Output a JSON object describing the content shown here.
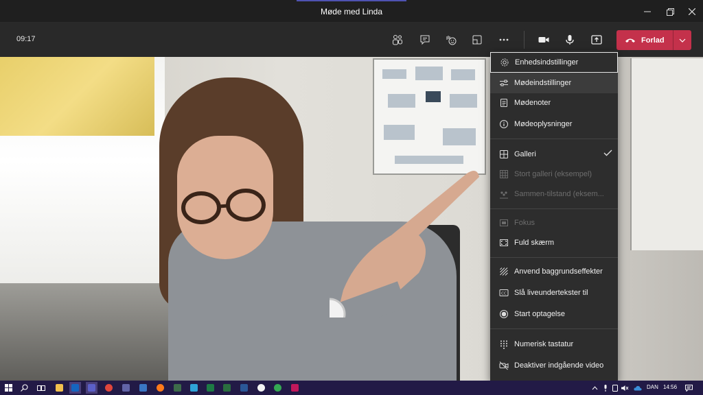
{
  "window": {
    "title": "Møde med Linda"
  },
  "toolbar": {
    "time": "09:17",
    "leave_label": "Forlad",
    "buttons": [
      "people-icon",
      "chat-icon",
      "raise-hand-icon",
      "breakout-icon",
      "more-icon",
      "camera-icon",
      "mic-icon",
      "share-icon"
    ]
  },
  "menu": {
    "items": [
      {
        "id": "device-settings",
        "label": "Enhedsindstillinger",
        "icon": "gear-icon",
        "state": "focused"
      },
      {
        "id": "meeting-settings",
        "label": "Mødeindstillinger",
        "icon": "sliders-icon",
        "state": "hover"
      },
      {
        "id": "meeting-notes",
        "label": "Mødenoter",
        "icon": "notes-icon",
        "state": "normal"
      },
      {
        "id": "meeting-info",
        "label": "Mødeoplysninger",
        "icon": "info-icon",
        "state": "normal"
      },
      {
        "id": "gallery",
        "label": "Galleri",
        "icon": "grid-icon",
        "state": "checked"
      },
      {
        "id": "large-gallery",
        "label": "Stort galleri (eksempel)",
        "icon": "large-grid-icon",
        "state": "disabled"
      },
      {
        "id": "together-mode",
        "label": "Sammen-tilstand (eksem...",
        "icon": "together-icon",
        "state": "disabled"
      },
      {
        "id": "focus",
        "label": "Fokus",
        "icon": "focus-icon",
        "state": "disabled"
      },
      {
        "id": "fullscreen",
        "label": "Fuld skærm",
        "icon": "fullscreen-icon",
        "state": "normal"
      },
      {
        "id": "background-effects",
        "label": "Anvend baggrundseffekter",
        "icon": "background-icon",
        "state": "normal"
      },
      {
        "id": "live-captions",
        "label": "Slå liveundertekster til",
        "icon": "cc-icon",
        "state": "normal"
      },
      {
        "id": "start-recording",
        "label": "Start optagelse",
        "icon": "record-icon",
        "state": "normal"
      },
      {
        "id": "keypad",
        "label": "Numerisk tastatur",
        "icon": "keypad-icon",
        "state": "normal"
      },
      {
        "id": "disable-video",
        "label": "Deaktiver indgående video",
        "icon": "video-off-icon",
        "state": "normal"
      }
    ]
  },
  "taskbar": {
    "language": "DAN",
    "clock": "14:56"
  },
  "colors": {
    "leave": "#c4314b",
    "accent": "#4f52b2",
    "menu_bg": "#2d2d2d",
    "taskbar": "#221a46"
  }
}
